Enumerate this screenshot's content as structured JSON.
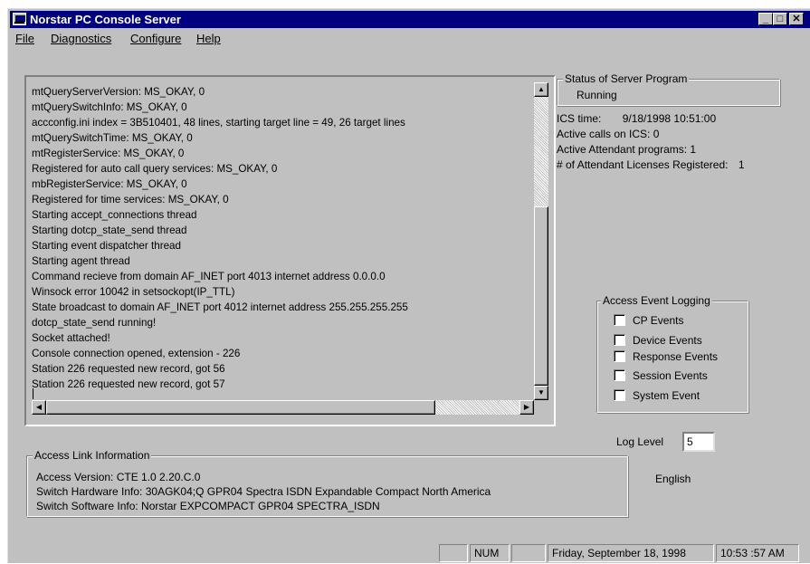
{
  "window": {
    "title": "Norstar PC Console Server",
    "minimize_glyph": "_",
    "maximize_glyph": "□",
    "close_glyph": "✕"
  },
  "menu": {
    "file": "File",
    "diagnostics": "Diagnostics",
    "configure": "Configure",
    "help": "Help"
  },
  "log": {
    "lines": [
      "mtQueryServerVersion: MS_OKAY, 0",
      "mtQuerySwitchInfo: MS_OKAY, 0",
      "accconfig.ini index = 3B510401, 48 lines, starting target line = 49, 26 target lines",
      "mtQuerySwitchTime: MS_OKAY, 0",
      "mtRegisterService: MS_OKAY, 0",
      "Registered for auto call query services: MS_OKAY, 0",
      "mbRegisterService: MS_OKAY, 0",
      "Registered for time services: MS_OKAY, 0",
      "Starting accept_connections thread",
      "Starting dotcp_state_send thread",
      "Starting event dispatcher thread",
      "Starting agent thread",
      "Command recieve from domain AF_INET port 4013 internet address 0.0.0.0",
      "Winsock error 10042 in setsockopt(IP_TTL)",
      "State broadcast to domain AF_INET port 4012 internet address 255.255.255.255",
      "dotcp_state_send running!",
      "Socket attached!",
      "Console connection opened, extension - 226",
      "Station 226 requested new record, got 56",
      "Station 226 requested new record, got 57"
    ],
    "scroll_up_glyph": "▲",
    "scroll_down_glyph": "▼",
    "scroll_left_glyph": "◀",
    "scroll_right_glyph": "▶"
  },
  "server_status": {
    "group_label": "Status of Server Program",
    "value": "Running"
  },
  "ics": {
    "time_label": "ICS time:",
    "time_value": "9/18/1998 10:51:00",
    "active_calls": "Active calls on ICS:  0",
    "attendant_programs": "Active Attendant programs:  1",
    "licenses_label": "# of Attendant Licenses Registered:",
    "licenses_value": "1"
  },
  "event_logging": {
    "group_label": "Access Event Logging",
    "options": [
      {
        "label": "CP Events",
        "checked": false
      },
      {
        "label": "Device Events",
        "checked": false
      },
      {
        "label": "Response Events",
        "checked": false
      },
      {
        "label": "Session Events",
        "checked": false
      },
      {
        "label": "System Event",
        "checked": false
      }
    ]
  },
  "log_level": {
    "label": "Log Level",
    "value": "5"
  },
  "language": "English",
  "access_link": {
    "group_label": "Access Link Information",
    "version": "Access Version:  CTE 1.0 2.20.C.0",
    "hardware": "Switch Hardware Info:  30AGK04;Q GPR04 Spectra ISDN Expandable Compact North America",
    "software": "Switch Software Info:  Norstar EXPCOMPACT GPR04 SPECTRA_ISDN"
  },
  "status_bar": {
    "num_lock": "NUM",
    "date": "Friday, September 18, 1998",
    "time": "10:53 :57 AM"
  },
  "colors": {
    "face": "#c0c0c0",
    "titlebar": "#000080",
    "shadow": "#808080"
  }
}
